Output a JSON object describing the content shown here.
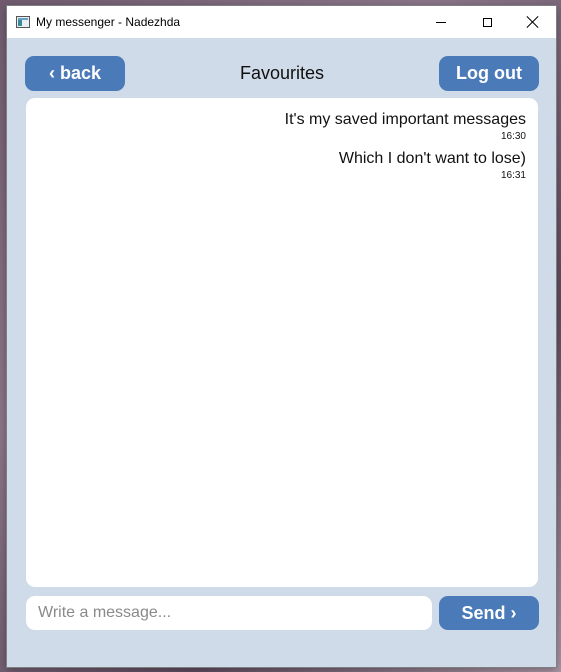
{
  "window": {
    "title": "My messenger - Nadezhda"
  },
  "header": {
    "back_label": "‹ back",
    "title": "Favourites",
    "logout_label": "Log out"
  },
  "messages": [
    {
      "text": "It's my saved important messages",
      "time": "16:30"
    },
    {
      "text": "Which I don't want to lose)",
      "time": "16:31"
    }
  ],
  "composer": {
    "placeholder": "Write a message...",
    "value": "",
    "send_label": "Send ›"
  },
  "colors": {
    "accent": "#4a7ab8",
    "window_bg": "#cfdbe8",
    "panel_bg": "#ffffff"
  },
  "icons": {
    "app": "app-window-icon",
    "minimize": "minimize-icon",
    "maximize": "maximize-icon",
    "close": "close-icon"
  }
}
